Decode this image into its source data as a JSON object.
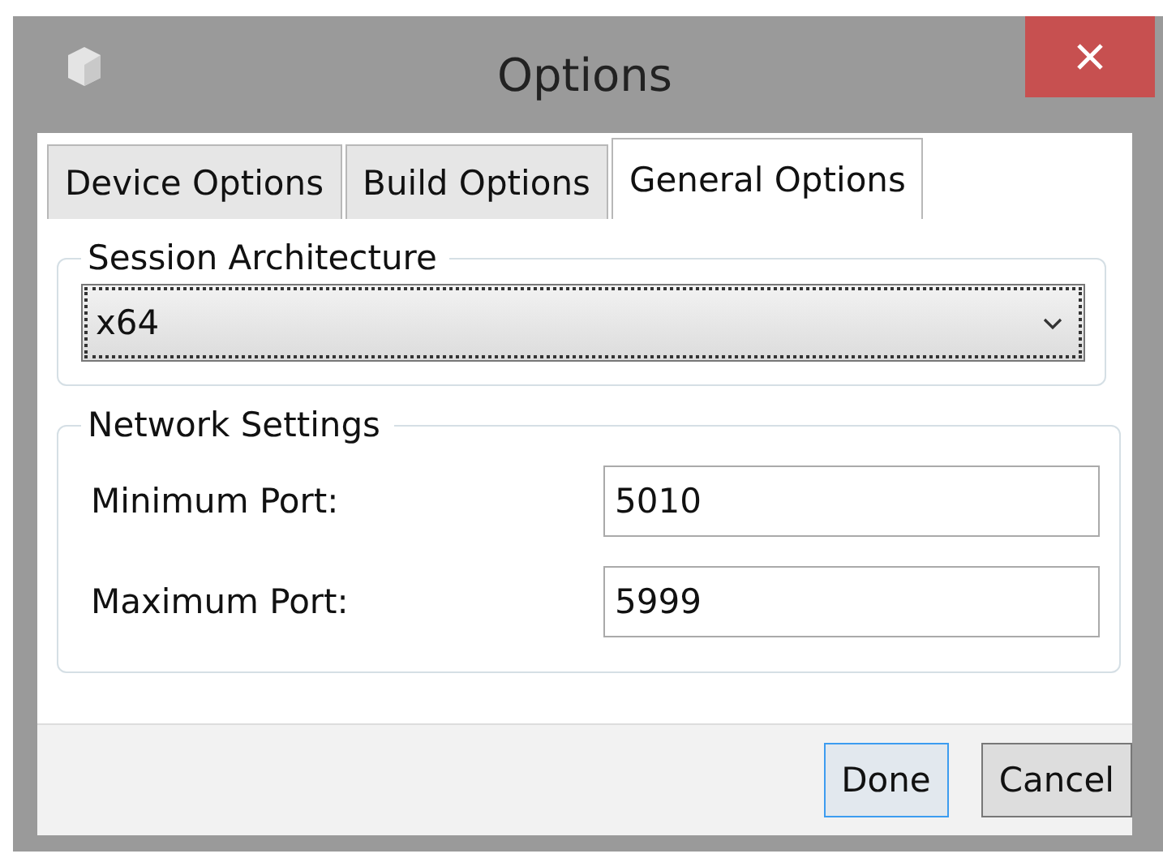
{
  "window": {
    "title": "Options"
  },
  "tabs": [
    {
      "label": "Device Options",
      "selected": false
    },
    {
      "label": "Build Options",
      "selected": false
    },
    {
      "label": "General Options",
      "selected": true
    }
  ],
  "session_architecture": {
    "title": "Session Architecture",
    "value": "x64",
    "focused": true
  },
  "network_settings": {
    "title": "Network Settings",
    "fields": [
      {
        "label": "Minimum Port:",
        "value": "5010"
      },
      {
        "label": "Maximum Port:",
        "value": "5999"
      }
    ]
  },
  "buttons": [
    {
      "label": "Done",
      "default": true
    },
    {
      "label": "Cancel",
      "default": false
    }
  ]
}
